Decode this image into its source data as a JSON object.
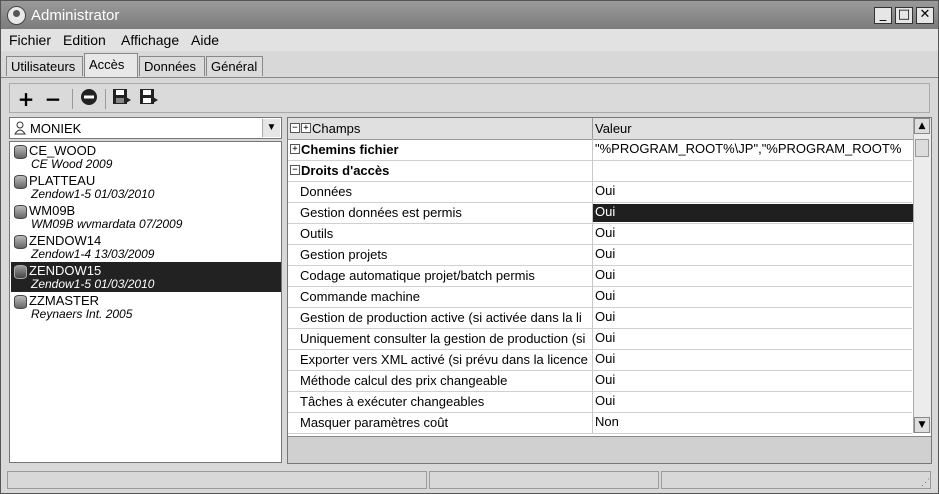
{
  "window": {
    "title": "Administrator",
    "controls": [
      "_",
      "□",
      "✕"
    ]
  },
  "menu": {
    "items": [
      "Fichier",
      "Edition",
      "Affichage",
      "Aide"
    ]
  },
  "tabs": [
    {
      "label": "Utilisateurs",
      "active": false
    },
    {
      "label": "Accès",
      "active": true
    },
    {
      "label": "Données",
      "active": false
    },
    {
      "label": "Général",
      "active": false
    }
  ],
  "toolbar": {
    "icons": [
      "plus-icon",
      "minus-icon",
      "delete-circle-icon",
      "save-icon",
      "save-as-icon"
    ]
  },
  "user_combo": {
    "value": "MONIEK"
  },
  "databases": [
    {
      "name": "CE_WOOD",
      "sub": "CE Wood 2009",
      "selected": false
    },
    {
      "name": "PLATTEAU",
      "sub": "Zendow1-5 01/03/2010",
      "selected": false
    },
    {
      "name": "WM09B",
      "sub": "WM09B wvmardata 07/2009",
      "selected": false
    },
    {
      "name": "ZENDOW14",
      "sub": "Zendow1-4 13/03/2009",
      "selected": false
    },
    {
      "name": "ZENDOW15",
      "sub": "Zendow1-5 01/03/2010",
      "selected": true
    },
    {
      "name": "ZZMASTER",
      "sub": "Reynaers Int. 2005",
      "selected": false
    }
  ],
  "grid": {
    "col_field": "Champs",
    "col_value": "Valeur",
    "rows": [
      {
        "type": "category",
        "expander": "+",
        "label": "Chemins fichier",
        "value": "\"%PROGRAM_ROOT%\\JP\",\"%PROGRAM_ROOT%",
        "selected": false
      },
      {
        "type": "category",
        "expander": "−",
        "label": "Droits d'accès",
        "value": "",
        "selected": false
      },
      {
        "type": "item",
        "label": "Données",
        "value": "Oui",
        "selected": false
      },
      {
        "type": "item",
        "label": "Gestion données est permis",
        "value": "Oui",
        "selected": true
      },
      {
        "type": "item",
        "label": "Outils",
        "value": "Oui",
        "selected": false
      },
      {
        "type": "item",
        "label": "Gestion projets",
        "value": "Oui",
        "selected": false
      },
      {
        "type": "item",
        "label": "Codage automatique projet/batch permis",
        "value": "Oui",
        "selected": false
      },
      {
        "type": "item",
        "label": "Commande machine",
        "value": "Oui",
        "selected": false
      },
      {
        "type": "item",
        "label": "Gestion de production active (si activée dans la li",
        "value": "Oui",
        "selected": false
      },
      {
        "type": "item",
        "label": "Uniquement consulter la gestion de production (si",
        "value": "Oui",
        "selected": false
      },
      {
        "type": "item",
        "label": "Exporter vers XML activé (si prévu dans la licence",
        "value": "Oui",
        "selected": false
      },
      {
        "type": "item",
        "label": "Méthode calcul des prix changeable",
        "value": "Oui",
        "selected": false
      },
      {
        "type": "item",
        "label": "Tâches à exécuter changeables",
        "value": "Oui",
        "selected": false
      },
      {
        "type": "item",
        "label": "Masquer paramètres coût",
        "value": "Non",
        "selected": false
      }
    ]
  }
}
